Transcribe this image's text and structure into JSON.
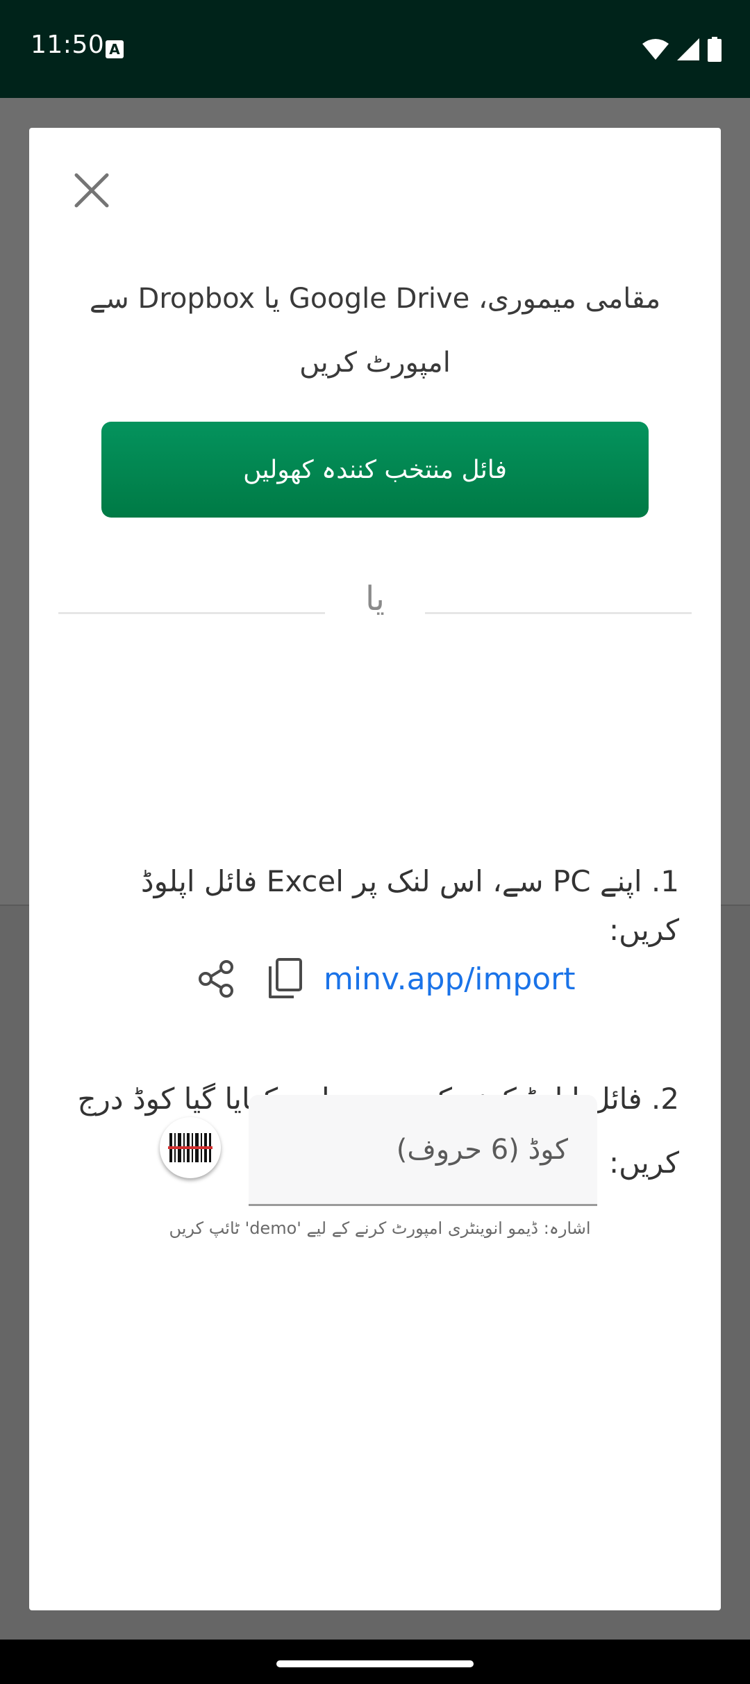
{
  "status_bar": {
    "time": "11:50",
    "notification_icon": "a-letter-icon",
    "icons": [
      "wifi-icon",
      "signal-icon",
      "battery-icon"
    ]
  },
  "dialog": {
    "close_icon": "close-icon",
    "import_title": "مقامی میموری، Google Drive یا Dropbox سے امپورٹ کریں",
    "open_file_button_label": "فائل منتخب کنندہ کھولیں",
    "divider_text": "یا",
    "step_one_text": "1. اپنے PC سے، اس لنک پر Excel فائل اپلوڈ کریں:",
    "import_link": "minv.app/import",
    "share_icon": "share-icon",
    "copy_icon": "copy-icon",
    "step_two_text": "2. فائل اپلوڈ کرنے کے بعد، یہاں دکھایا گیا کوڈ درج کریں:",
    "barcode_icon": "barcode-scan-icon",
    "code_placeholder": "کوڈ (6 حروف)",
    "code_value": "",
    "hint_text": "اشارہ: ڈیمو انوینٹری امپورٹ کرنے کے لیے 'demo' ٹائپ کریں"
  },
  "colors": {
    "status_bar_bg": "#00231a",
    "button_green": "#007a45",
    "link_blue": "#1a73e8"
  }
}
